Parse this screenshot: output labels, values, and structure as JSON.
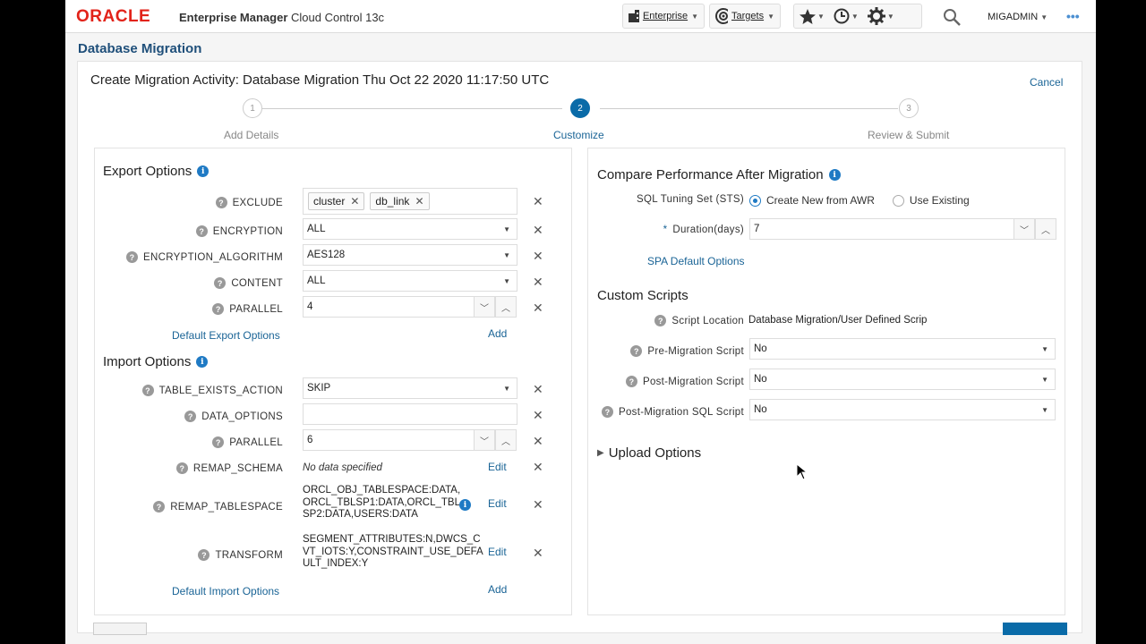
{
  "header": {
    "logo": "ORACLE",
    "product_bold": "Enterprise Manager",
    "product_rest": "Cloud Control 13c",
    "enterprise_label": "Enterprise",
    "targets_label": "Targets",
    "user_label": "MIGADMIN",
    "more_label": "•••"
  },
  "page_title": "Database Migration",
  "activity_title": "Create Migration Activity: Database Migration Thu Oct 22 2020 11:17:50 UTC",
  "cancel_label": "Cancel",
  "train": [
    {
      "number": "1",
      "label": "Add Details",
      "active": false
    },
    {
      "number": "2",
      "label": "Customize",
      "active": true
    },
    {
      "number": "3",
      "label": "Review & Submit",
      "active": false
    }
  ],
  "export": {
    "title": "Export Options",
    "exclude_label": "EXCLUDE",
    "exclude_chips": [
      "cluster",
      "db_link"
    ],
    "encryption_label": "ENCRYPTION",
    "encryption_value": "ALL",
    "encryption_algorithm_label": "ENCRYPTION_ALGORITHM",
    "encryption_algorithm_value": "AES128",
    "content_label": "CONTENT",
    "content_value": "ALL",
    "parallel_label": "PARALLEL",
    "parallel_value": "4",
    "default_link": "Default Export Options",
    "add_label": "Add"
  },
  "import": {
    "title": "Import Options",
    "table_exists_label": "TABLE_EXISTS_ACTION",
    "table_exists_value": "SKIP",
    "data_options_label": "DATA_OPTIONS",
    "data_options_value": "",
    "parallel_label": "PARALLEL",
    "parallel_value": "6",
    "remap_schema_label": "REMAP_SCHEMA",
    "remap_schema_value": "No data specified",
    "remap_tablespace_label": "REMAP_TABLESPACE",
    "remap_tablespace_lines": [
      "ORCL_OBJ_TABLESPACE:DATA,",
      "ORCL_TBLSP1:DATA,ORCL_TBL",
      "SP2:DATA,USERS:DATA"
    ],
    "transform_label": "TRANSFORM",
    "transform_lines": [
      "SEGMENT_ATTRIBUTES:N,DWCS_C",
      "VT_IOTS:Y,CONSTRAINT_USE_DEFA",
      "ULT_INDEX:Y"
    ],
    "edit_label": "Edit",
    "default_link": "Default Import Options",
    "add_label": "Add"
  },
  "compare": {
    "title": "Compare Performance After Migration",
    "sts_label": "SQL Tuning Set (STS)",
    "sts_options": [
      "Create New from AWR",
      "Use Existing"
    ],
    "sts_selected": "Create New from AWR",
    "duration_required": "*",
    "duration_label": "Duration(days)",
    "duration_value": "7",
    "spa_link": "SPA Default Options"
  },
  "scripts": {
    "title": "Custom Scripts",
    "location_label": "Script Location",
    "location_value": "Database Migration/User Defined Scrip",
    "pre_label": "Pre-Migration Script",
    "pre_value": "No",
    "post_label": "Post-Migration Script",
    "post_value": "No",
    "post_sql_label": "Post-Migration SQL Script",
    "post_sql_value": "No"
  },
  "upload": {
    "title": "Upload Options"
  },
  "colors": {
    "accent": "#0a6ba8",
    "link": "#1a6496",
    "oracle_red": "#e2231a"
  }
}
